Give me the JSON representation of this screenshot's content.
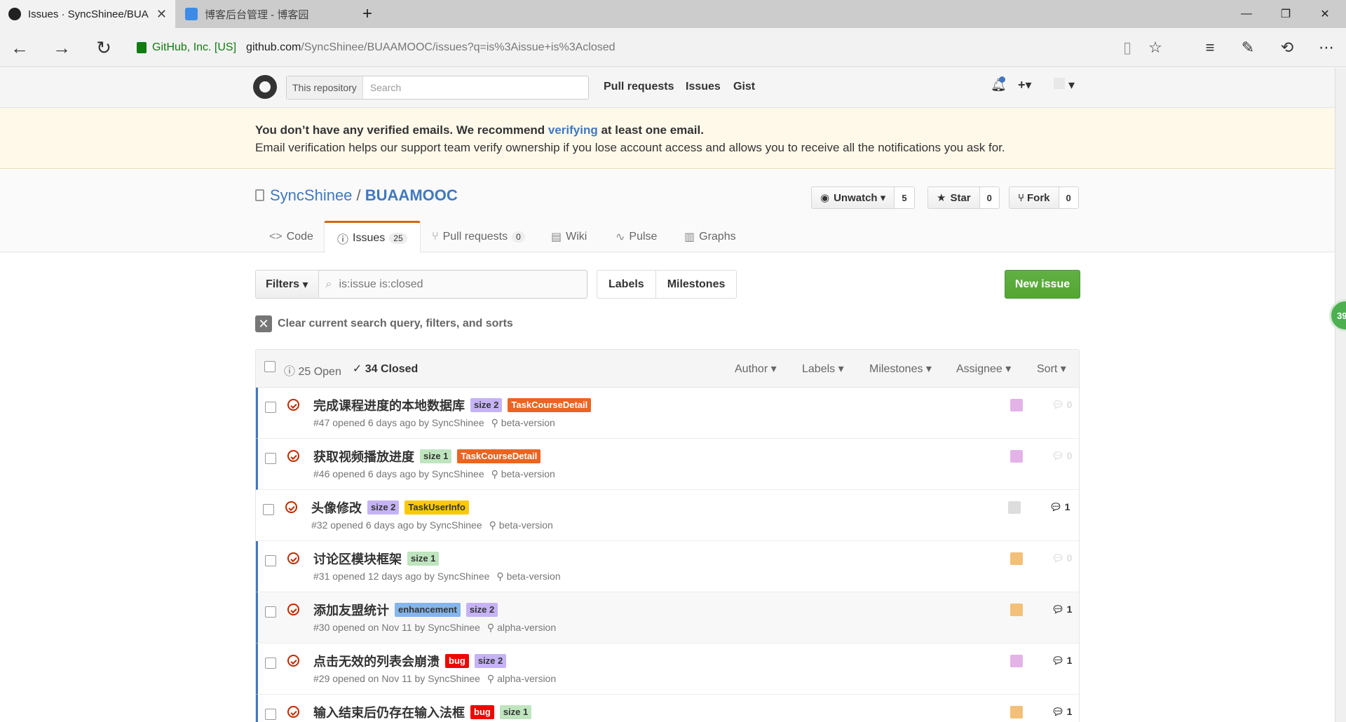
{
  "browser": {
    "tabs": [
      {
        "title": "Issues · SyncShinee/BUA",
        "active": true
      },
      {
        "title": "博客后台管理 - 博客园",
        "active": false
      }
    ],
    "new_tab": "+",
    "cert": "GitHub, Inc. [US]",
    "url_host": "github.com",
    "url_path": "/SyncShinee/BUAAMOOC/issues?q=is%3Aissue+is%3Aclosed"
  },
  "header": {
    "search_scope": "This repository",
    "search_placeholder": "Search",
    "nav": [
      "Pull requests",
      "Issues",
      "Gist"
    ]
  },
  "flash": {
    "line1_a": "You don’t have any verified emails. We recommend ",
    "line1_link": "verifying",
    "line1_b": " at least one email.",
    "line2": "Email verification helps our support team verify ownership if you lose account access and allows you to receive all the notifications you ask for."
  },
  "repo": {
    "owner": "SyncShinee",
    "sep": " / ",
    "name": "BUAAMOOC",
    "watch_label": "Unwatch",
    "watch_count": "5",
    "star_label": "Star",
    "star_count": "0",
    "fork_label": "Fork",
    "fork_count": "0",
    "tabs": [
      {
        "label": "Code",
        "count": ""
      },
      {
        "label": "Issues",
        "count": "25"
      },
      {
        "label": "Pull requests",
        "count": "0"
      },
      {
        "label": "Wiki",
        "count": ""
      },
      {
        "label": "Pulse",
        "count": ""
      },
      {
        "label": "Graphs",
        "count": ""
      }
    ]
  },
  "subnav": {
    "filters_label": "Filters",
    "query": "is:issue is:closed",
    "labels_btn": "Labels",
    "milestones_btn": "Milestones",
    "new_issue": "New issue",
    "clear": "Clear current search query, filters, and sorts"
  },
  "table": {
    "open": "25 Open",
    "closed": "34 Closed",
    "filters": [
      "Author",
      "Labels",
      "Milestones",
      "Assignee",
      "Sort"
    ],
    "rows": [
      {
        "title": "完成课程进度的本地数据库",
        "labels": [
          {
            "t": "size 2",
            "bg": "#c5b3f5",
            "fg": "#333"
          },
          {
            "t": "TaskCourseDetail",
            "bg": "#eb6420",
            "fg": "#fff"
          }
        ],
        "meta": "#47 opened 6 days ago by SyncShinee",
        "milestone": "beta-version",
        "comments": "0",
        "avatar": "#e3b3e8"
      },
      {
        "title": "获取视频播放进度",
        "labels": [
          {
            "t": "size 1",
            "bg": "#bfe5bf",
            "fg": "#333"
          },
          {
            "t": "TaskCourseDetail",
            "bg": "#eb6420",
            "fg": "#fff"
          }
        ],
        "meta": "#46 opened 6 days ago by SyncShinee",
        "milestone": "beta-version",
        "comments": "0",
        "avatar": "#e3b3e8"
      },
      {
        "title": "头像修改",
        "labels": [
          {
            "t": "size 2",
            "bg": "#c5b3f5",
            "fg": "#333"
          },
          {
            "t": "TaskUserInfo",
            "bg": "#fbca04",
            "fg": "#333"
          }
        ],
        "meta": "#32 opened 6 days ago by SyncShinee",
        "milestone": "beta-version",
        "comments": "1",
        "avatar": "#dddddd"
      },
      {
        "title": "讨论区模块框架",
        "labels": [
          {
            "t": "size 1",
            "bg": "#bfe5bf",
            "fg": "#333"
          }
        ],
        "meta": "#31 opened 12 days ago by SyncShinee",
        "milestone": "beta-version",
        "comments": "0",
        "avatar": "#f2c078"
      },
      {
        "title": "添加友盟统计",
        "labels": [
          {
            "t": "enhancement",
            "bg": "#84b6eb",
            "fg": "#333"
          },
          {
            "t": "size 2",
            "bg": "#c5b3f5",
            "fg": "#333"
          }
        ],
        "meta": "#30 opened on Nov 11 by SyncShinee",
        "milestone": "alpha-version",
        "comments": "1",
        "avatar": "#f2c078"
      },
      {
        "title": "点击无效的列表会崩溃",
        "labels": [
          {
            "t": "bug",
            "bg": "#ee0701",
            "fg": "#fff"
          },
          {
            "t": "size 2",
            "bg": "#c5b3f5",
            "fg": "#333"
          }
        ],
        "meta": "#29 opened on Nov 11 by SyncShinee",
        "milestone": "alpha-version",
        "comments": "1",
        "avatar": "#e3b3e8"
      },
      {
        "title": "输入结束后仍存在输入法框",
        "labels": [
          {
            "t": "bug",
            "bg": "#ee0701",
            "fg": "#fff"
          },
          {
            "t": "size 1",
            "bg": "#bfe5bf",
            "fg": "#333"
          }
        ],
        "meta": "",
        "milestone": "",
        "comments": "1",
        "avatar": "#f2c078"
      }
    ]
  },
  "bubble": "39"
}
